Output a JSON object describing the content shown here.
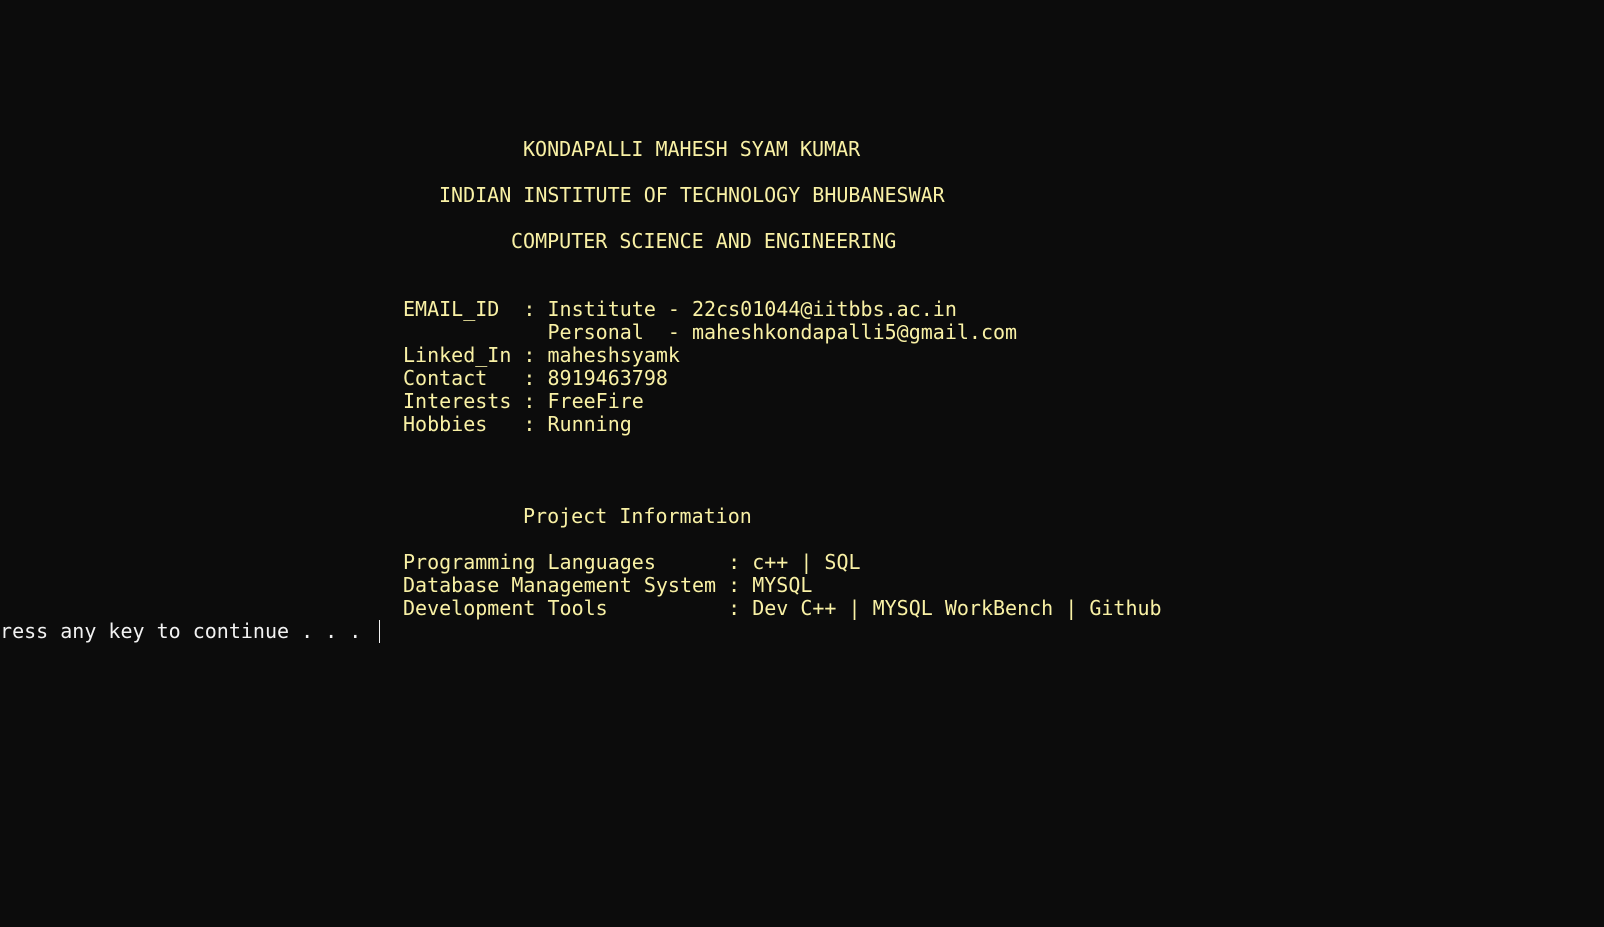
{
  "header": {
    "name": "KONDAPALLI MAHESH SYAM KUMAR",
    "institute": "INDIAN INSTITUTE OF TECHNOLOGY BHUBANESWAR",
    "department": "COMPUTER SCIENCE AND ENGINEERING"
  },
  "profile": {
    "email_institute": "EMAIL_ID  : Institute - 22cs01044@iitbbs.ac.in",
    "email_personal": "            Personal  - maheshkondapalli5@gmail.com",
    "linkedin": "Linked_In : maheshsyamk",
    "contact": "Contact   : 8919463798",
    "interests": "Interests : FreeFire",
    "hobbies": "Hobbies   : Running"
  },
  "project": {
    "title": "Project Information",
    "languages": "Programming Languages      : c++ | SQL",
    "dbms": "Database Management System : MYSQL",
    "tools": "Development Tools          : Dev C++ | MYSQL WorkBench | Github"
  },
  "prompt": {
    "text": "Press any key to continue . . . "
  },
  "colors": {
    "background": "#0c0c0c",
    "text": "#f9f1a5",
    "prompt": "#f2f2f2"
  }
}
